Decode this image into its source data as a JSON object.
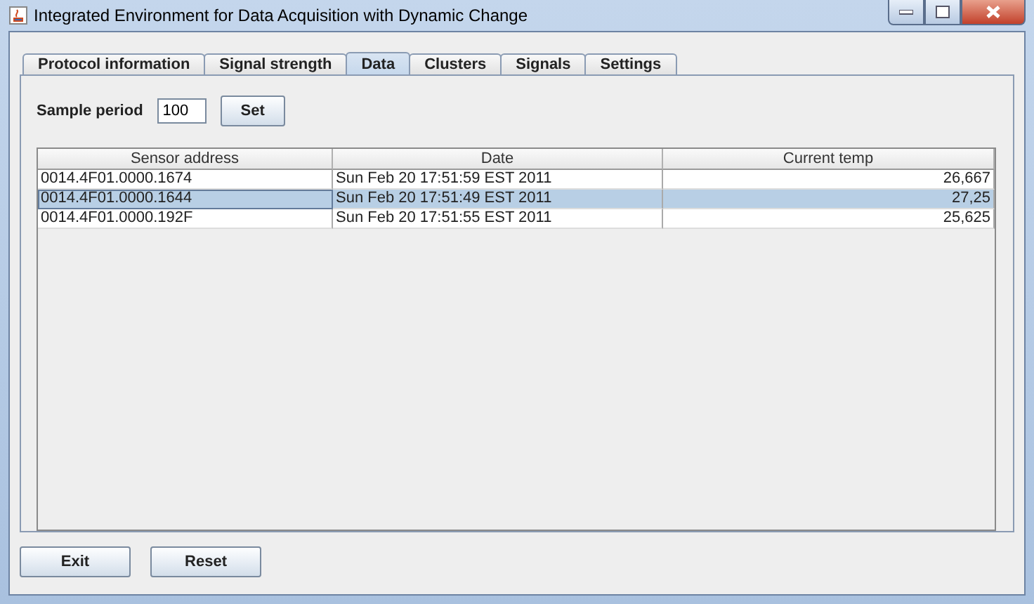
{
  "window": {
    "title": "Integrated Environment for Data Acquisition with Dynamic Change"
  },
  "tabs": [
    {
      "label": "Protocol information",
      "selected": false
    },
    {
      "label": "Signal strength",
      "selected": false
    },
    {
      "label": "Data",
      "selected": true
    },
    {
      "label": "Clusters",
      "selected": false
    },
    {
      "label": "Signals",
      "selected": false
    },
    {
      "label": "Settings",
      "selected": false
    }
  ],
  "sample_period": {
    "label": "Sample period",
    "value": "100",
    "button": "Set"
  },
  "table": {
    "columns": [
      "Sensor address",
      "Date",
      "Current temp"
    ],
    "rows": [
      {
        "cells": [
          "0014.4F01.0000.1674",
          "Sun Feb 20 17:51:59 EST 2011",
          "26,667"
        ],
        "selected": false
      },
      {
        "cells": [
          "0014.4F01.0000.1644",
          "Sun Feb 20 17:51:49 EST 2011",
          "27,25"
        ],
        "selected": true
      },
      {
        "cells": [
          "0014.4F01.0000.192F",
          "Sun Feb 20 17:51:55 EST 2011",
          "25,625"
        ],
        "selected": false
      }
    ]
  },
  "buttons": [
    "Exit",
    "Reset"
  ]
}
